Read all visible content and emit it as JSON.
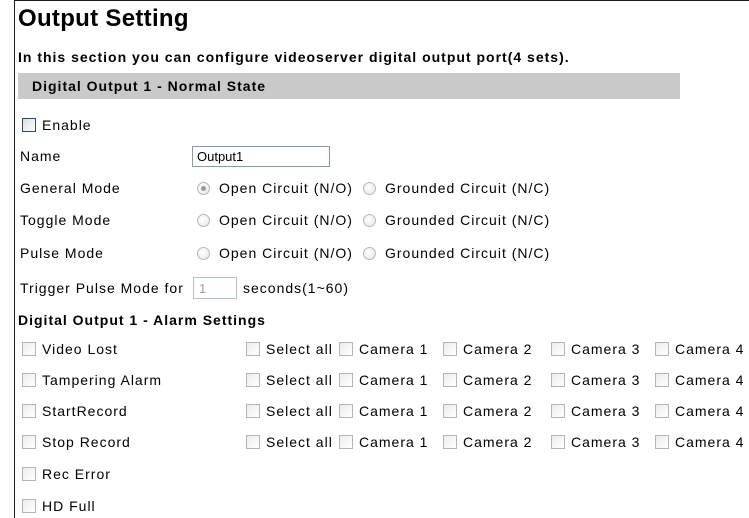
{
  "page": {
    "title": "Output Setting",
    "description": "In this section you can configure videoserver digital output port(4 sets)."
  },
  "normal_state": {
    "header": "Digital Output 1 - Normal State",
    "enable": {
      "label": "Enable",
      "checked": false
    },
    "name": {
      "label": "Name",
      "value": "Output1"
    },
    "modes": [
      {
        "label": "General Mode",
        "options": [
          {
            "label": "Open Circuit (N/O)",
            "selected": true
          },
          {
            "label": "Grounded Circuit (N/C)",
            "selected": false
          }
        ]
      },
      {
        "label": "Toggle Mode",
        "options": [
          {
            "label": "Open Circuit (N/O)",
            "selected": false
          },
          {
            "label": "Grounded Circuit (N/C)",
            "selected": false
          }
        ]
      },
      {
        "label": "Pulse Mode",
        "options": [
          {
            "label": "Open Circuit (N/O)",
            "selected": false
          },
          {
            "label": "Grounded Circuit (N/C)",
            "selected": false
          }
        ]
      }
    ],
    "trigger_pulse": {
      "label": "Trigger Pulse Mode for",
      "value": "1",
      "unit": "seconds(1~60)"
    }
  },
  "alarm_settings": {
    "header": "Digital Output 1 - Alarm Settings",
    "events": [
      {
        "label": "Video Lost",
        "checked": false,
        "select_all": {
          "label": "Select all",
          "checked": false
        },
        "cameras": [
          {
            "label": "Camera 1",
            "checked": false
          },
          {
            "label": "Camera 2",
            "checked": false
          },
          {
            "label": "Camera 3",
            "checked": false
          },
          {
            "label": "Camera 4",
            "checked": false
          }
        ]
      },
      {
        "label": "Tampering Alarm",
        "checked": false,
        "select_all": {
          "label": "Select all",
          "checked": false
        },
        "cameras": [
          {
            "label": "Camera 1",
            "checked": false
          },
          {
            "label": "Camera 2",
            "checked": false
          },
          {
            "label": "Camera 3",
            "checked": false
          },
          {
            "label": "Camera 4",
            "checked": false
          }
        ]
      },
      {
        "label": "StartRecord",
        "checked": false,
        "select_all": {
          "label": "Select all",
          "checked": false
        },
        "cameras": [
          {
            "label": "Camera 1",
            "checked": false
          },
          {
            "label": "Camera 2",
            "checked": false
          },
          {
            "label": "Camera 3",
            "checked": false
          },
          {
            "label": "Camera 4",
            "checked": false
          }
        ]
      },
      {
        "label": "Stop Record",
        "checked": false,
        "select_all": {
          "label": "Select all",
          "checked": false
        },
        "cameras": [
          {
            "label": "Camera 1",
            "checked": false
          },
          {
            "label": "Camera 2",
            "checked": false
          },
          {
            "label": "Camera 3",
            "checked": false
          },
          {
            "label": "Camera 4",
            "checked": false
          }
        ]
      },
      {
        "label": "Rec Error",
        "checked": false
      },
      {
        "label": "HD Full",
        "checked": false
      }
    ]
  },
  "colors": {
    "section_header_bg": "#c9c9c9",
    "frame_border": "#1a1a1a",
    "input_border": "#7f9db9",
    "inactive_input_border": "#b3c0cf",
    "checkbox_border": "#b5b5b5",
    "enable_checkbox_border": "#1c5180",
    "radio_border": "#b9b9b9",
    "radio_dot": "#9a9a9a",
    "muted_text": "#a0a0a0",
    "text": "#000000"
  }
}
